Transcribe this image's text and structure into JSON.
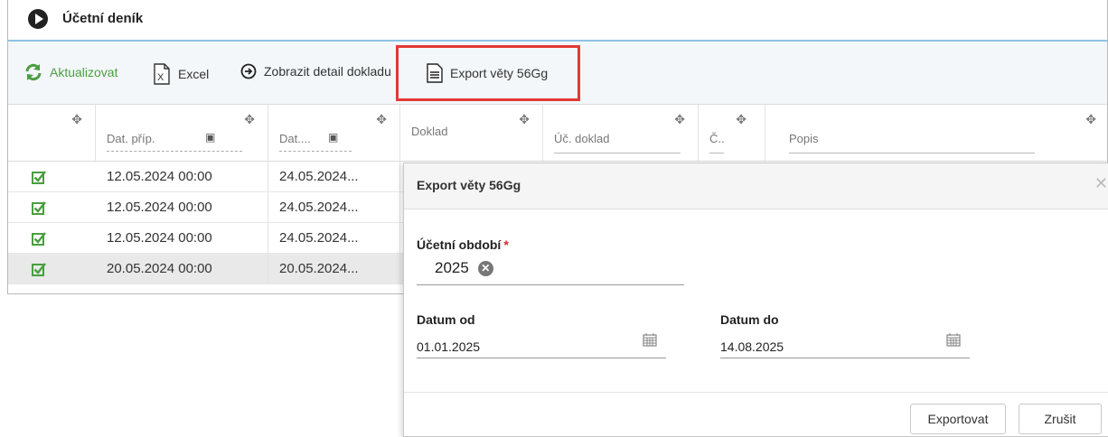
{
  "window": {
    "title": "Účetní deník"
  },
  "toolbar": {
    "refresh_label": "Aktualizovat",
    "excel_label": "Excel",
    "detail_label": "Zobrazit detail dokladu",
    "export_label": "Export věty 56Gg"
  },
  "grid": {
    "columns": [
      "Dat. příp.",
      "Dat....",
      "Doklad",
      "Úč. doklad",
      "Č..",
      "Popis"
    ],
    "rows": [
      {
        "dat_prip": "12.05.2024 00:00",
        "dat": "24.05.2024..."
      },
      {
        "dat_prip": "12.05.2024 00:00",
        "dat": "24.05.2024..."
      },
      {
        "dat_prip": "12.05.2024 00:00",
        "dat": "24.05.2024..."
      },
      {
        "dat_prip": "20.05.2024 00:00",
        "dat": "20.05.2024..."
      }
    ]
  },
  "dialog": {
    "title": "Export věty 56Gg",
    "period_label": "Účetní období",
    "period_required": "*",
    "period_value": "2025",
    "date_from_label": "Datum od",
    "date_from_value": "01.01.2025",
    "date_to_label": "Datum do",
    "date_to_value": "14.08.2025",
    "export_button": "Exportovat",
    "cancel_button": "Zrušit"
  },
  "colors": {
    "accent_green": "#4a9e3f",
    "highlight_red": "#e23a35",
    "title_underline": "#8fc3e6"
  },
  "icons": [
    "refresh-icon",
    "excel-icon",
    "arrow-circle-icon",
    "document-icon",
    "move-icon",
    "calendar-icon",
    "checkbox-checked-icon",
    "close-icon",
    "clear-chip-icon"
  ]
}
